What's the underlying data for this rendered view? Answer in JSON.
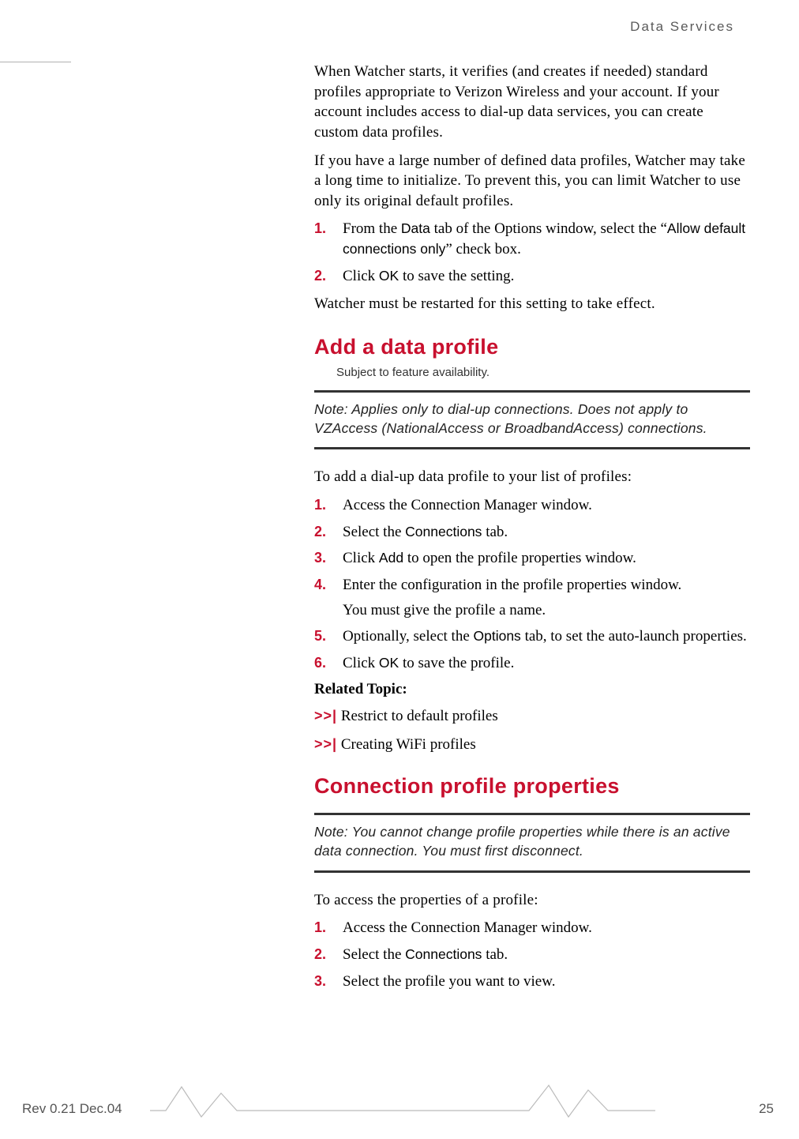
{
  "header": {
    "running": "Data Services"
  },
  "para1": "When Watcher starts, it verifies (and creates if needed) standard profiles appropriate to Verizon Wireless and your account. If your account includes access to dial-up data services, you can create custom data profiles.",
  "para2": "If you have a large number of defined data profiles, Watcher may take a long time to initialize. To prevent this, you can limit Watcher to use only its original default profiles.",
  "stepsA": {
    "s1_pre": "From the ",
    "s1_ui1": "Data",
    "s1_mid": " tab of the Options window, select the “",
    "s1_ui2": "Allow default connections only",
    "s1_post": "” check box.",
    "s2_pre": "Click ",
    "s2_ui": "OK",
    "s2_post": " to save the setting."
  },
  "para3": "Watcher must be restarted for this setting to take effect.",
  "section1": {
    "title": "Add a data profile",
    "subject": "Subject to feature availability.",
    "note": "Note:  Applies only to dial-up connections. Does not apply to VZAccess (NationalAccess or BroadbandAccess) connections.",
    "intro": "To add a dial-up data profile to your list of profiles:"
  },
  "stepsB": {
    "s1": "Access the Connection Manager window.",
    "s2_pre": "Select the ",
    "s2_ui": "Connections",
    "s2_post": " tab.",
    "s3_pre": "Click ",
    "s3_ui": "Add",
    "s3_post": " to open the profile properties window.",
    "s4": "Enter the configuration in the profile properties window.",
    "s4_sub": "You must give the profile a name.",
    "s5_pre": "Optionally, select the ",
    "s5_ui": "Options",
    "s5_post": " tab, to set the auto-launch properties.",
    "s6_pre": "Click ",
    "s6_ui": "OK",
    "s6_post": " to save the profile."
  },
  "related": {
    "head": "Related Topic:",
    "arrows": ">>|",
    "l1": " Restrict to default profiles",
    "l2": " Creating WiFi profiles"
  },
  "section2": {
    "title": "Connection profile properties",
    "note": "Note:  You cannot change profile properties while there is an active data connection. You must first disconnect.",
    "intro": "To access the properties of a profile:"
  },
  "stepsC": {
    "s1": "Access the Connection Manager window.",
    "s2_pre": "Select the ",
    "s2_ui": "Connections",
    "s2_post": " tab.",
    "s3": "Select the profile you want to view."
  },
  "footer": {
    "left": "Rev 0.21  Dec.04",
    "right": "25"
  },
  "nums": {
    "n1": "1.",
    "n2": "2.",
    "n3": "3.",
    "n4": "4.",
    "n5": "5.",
    "n6": "6."
  }
}
